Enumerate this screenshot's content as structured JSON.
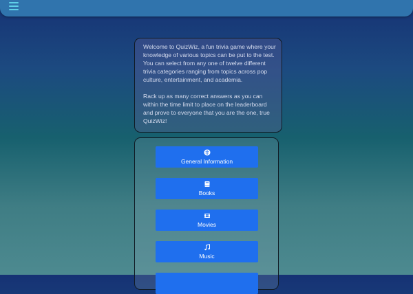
{
  "header": {
    "menu_icon": "hamburger-menu-icon",
    "accent": "#5fd0e8",
    "bar_color": "#3074ad"
  },
  "intro": {
    "paragraphs": [
      "Welcome to QuizWiz, a fun trivia game where your knowledge of various topics can be put to the test. You can select from any one of twelve different trivia categories ranging from topics across pop culture, entertainment, and academia.",
      "Rack up as many correct answers as you can within the time limit to place on the leaderboard and prove to everyone that you are the one, true QuizWiz!"
    ]
  },
  "categories": {
    "button_color": "#1f6fee",
    "items": [
      {
        "label": "General Information",
        "icon": "brain-icon"
      },
      {
        "label": "Books",
        "icon": "book-icon"
      },
      {
        "label": "Movies",
        "icon": "film-icon"
      },
      {
        "label": "Music",
        "icon": "music-note-icon"
      }
    ]
  }
}
